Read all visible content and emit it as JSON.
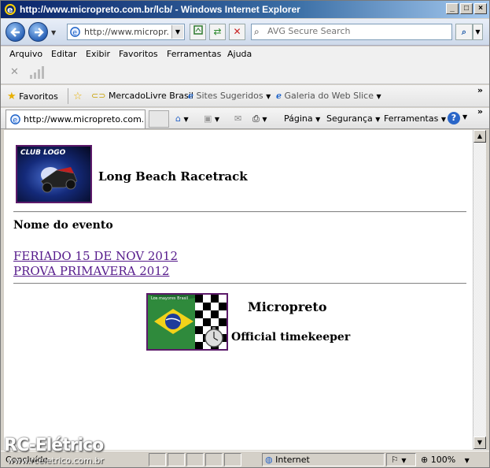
{
  "window": {
    "title": "http://www.micropreto.com.br/lcb/ - Windows Internet Explorer"
  },
  "address_bar": {
    "url": "http://www.micropr..."
  },
  "search": {
    "placeholder": "AVG Secure Search"
  },
  "menu": [
    "Arquivo",
    "Editar",
    "Exibir",
    "Favoritos",
    "Ferramentas",
    "Ajuda"
  ],
  "favorites_bar": {
    "favorites_label": "Favoritos",
    "items": [
      "MercadoLivre Brasil",
      "Sites Sugeridos",
      "Galeria do Web Slice"
    ]
  },
  "tab": {
    "label": "http://www.micropreto.com...."
  },
  "command_bar": {
    "page": "Página",
    "security": "Segurança",
    "tools": "Ferramentas"
  },
  "page": {
    "logo_text": "CLUB LOGO",
    "title": "Long Beach Racetrack",
    "events_heading": "Nome do evento",
    "events": [
      "FERIADO 15 DE NOV 2012",
      "PROVA PRIMAVERA 2012"
    ],
    "sponsor_logo_text": "Los mayores Brasil",
    "sponsor_name": "Micropreto",
    "sponsor_role": "Official timekeeper"
  },
  "status": {
    "text": "Concluído",
    "zone": "Internet",
    "zoom": "100%"
  },
  "watermark": {
    "title": "RC-Elétrico",
    "url": "www.rceletrico.com.br"
  },
  "colors": {
    "visited_link": "#551a8b",
    "logo_border": "#5c1a6a",
    "title_bar": "#0a246a"
  }
}
